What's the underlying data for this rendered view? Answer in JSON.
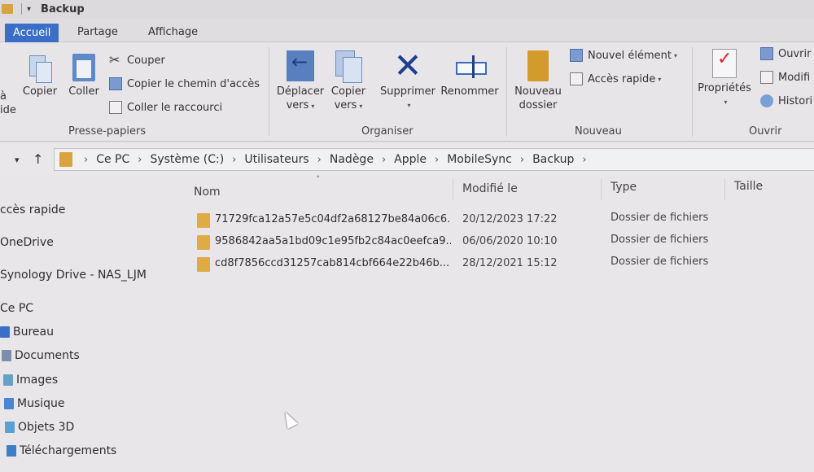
{
  "window": {
    "title": "Backup"
  },
  "tabs": [
    {
      "label": "Accueil",
      "active": true
    },
    {
      "label": "Partage",
      "active": false
    },
    {
      "label": "Affichage",
      "active": false
    }
  ],
  "ribbon": {
    "clipboard": {
      "pin_label_1": "à",
      "pin_label_2": "ide",
      "copy": "Copier",
      "paste": "Coller",
      "cut": "Couper",
      "copy_path": "Copier le chemin d'accès",
      "paste_shortcut": "Coller le raccourci",
      "group_label": "Presse-papiers"
    },
    "organize": {
      "move_to_1": "Déplacer",
      "move_to_2": "vers",
      "copy_to_1": "Copier",
      "copy_to_2": "vers",
      "delete": "Supprimer",
      "rename": "Renommer",
      "group_label": "Organiser"
    },
    "new": {
      "new_folder_1": "Nouveau",
      "new_folder_2": "dossier",
      "new_item": "Nouvel élément",
      "quick_access": "Accès rapide",
      "group_label": "Nouveau"
    },
    "open": {
      "properties": "Propriétés",
      "open": "Ouvrir",
      "edit": "Modifi",
      "history": "Histori",
      "group_label": "Ouvrir"
    }
  },
  "address": {
    "crumbs": [
      "Ce PC",
      "Système (C:)",
      "Utilisateurs",
      "Nadège",
      "Apple",
      "MobileSync",
      "Backup"
    ]
  },
  "nav": {
    "items": [
      {
        "label": "ccès rapide",
        "icon": "star-icon"
      },
      {
        "label": "OneDrive",
        "icon": "cloud-icon"
      },
      {
        "label": "Synology Drive - NAS_LJM",
        "icon": "drive-icon"
      },
      {
        "label": "Ce PC",
        "icon": "computer-icon"
      },
      {
        "label": "Bureau",
        "icon": "desktop-icon",
        "color": "#3a6fc7"
      },
      {
        "label": "Documents",
        "icon": "documents-icon",
        "color": "#7b8fa8"
      },
      {
        "label": "Images",
        "icon": "images-icon",
        "color": "#6aa0c8"
      },
      {
        "label": "Musique",
        "icon": "music-icon",
        "color": "#4a86d0"
      },
      {
        "label": "Objets 3D",
        "icon": "objects3d-icon",
        "color": "#5aa0d8"
      },
      {
        "label": "Téléchargements",
        "icon": "downloads-icon",
        "color": "#3a7fc8"
      }
    ]
  },
  "columns": {
    "name": "Nom",
    "modified": "Modifié le",
    "type": "Type",
    "size": "Taille"
  },
  "files": [
    {
      "name": "71729fca12a57e5c04df2a68127be84a06c6...",
      "modified": "20/12/2023 17:22",
      "type": "Dossier de fichiers"
    },
    {
      "name": "9586842aa5a1bd09c1e95fb2c84ac0eefca9...",
      "modified": "06/06/2020 10:10",
      "type": "Dossier de fichiers"
    },
    {
      "name": "cd8f7856ccd31257cab814cbf664e22b46b...",
      "modified": "28/12/2021 15:12",
      "type": "Dossier de fichiers"
    }
  ]
}
